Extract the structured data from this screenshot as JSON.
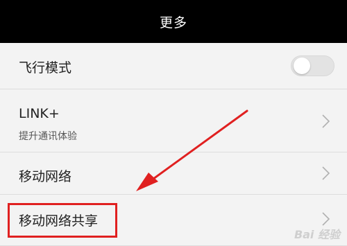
{
  "header": {
    "title": "更多"
  },
  "settings": {
    "items": [
      {
        "label": "飞行模式",
        "toggle_on": false
      },
      {
        "label": "LINK+",
        "subtitle": "提升通讯体验"
      },
      {
        "label": "移动网络"
      },
      {
        "label": "移动网络共享"
      }
    ]
  },
  "annotation": {
    "highlight_color": "#e02020"
  },
  "watermark": {
    "text": "Bai 经验"
  }
}
